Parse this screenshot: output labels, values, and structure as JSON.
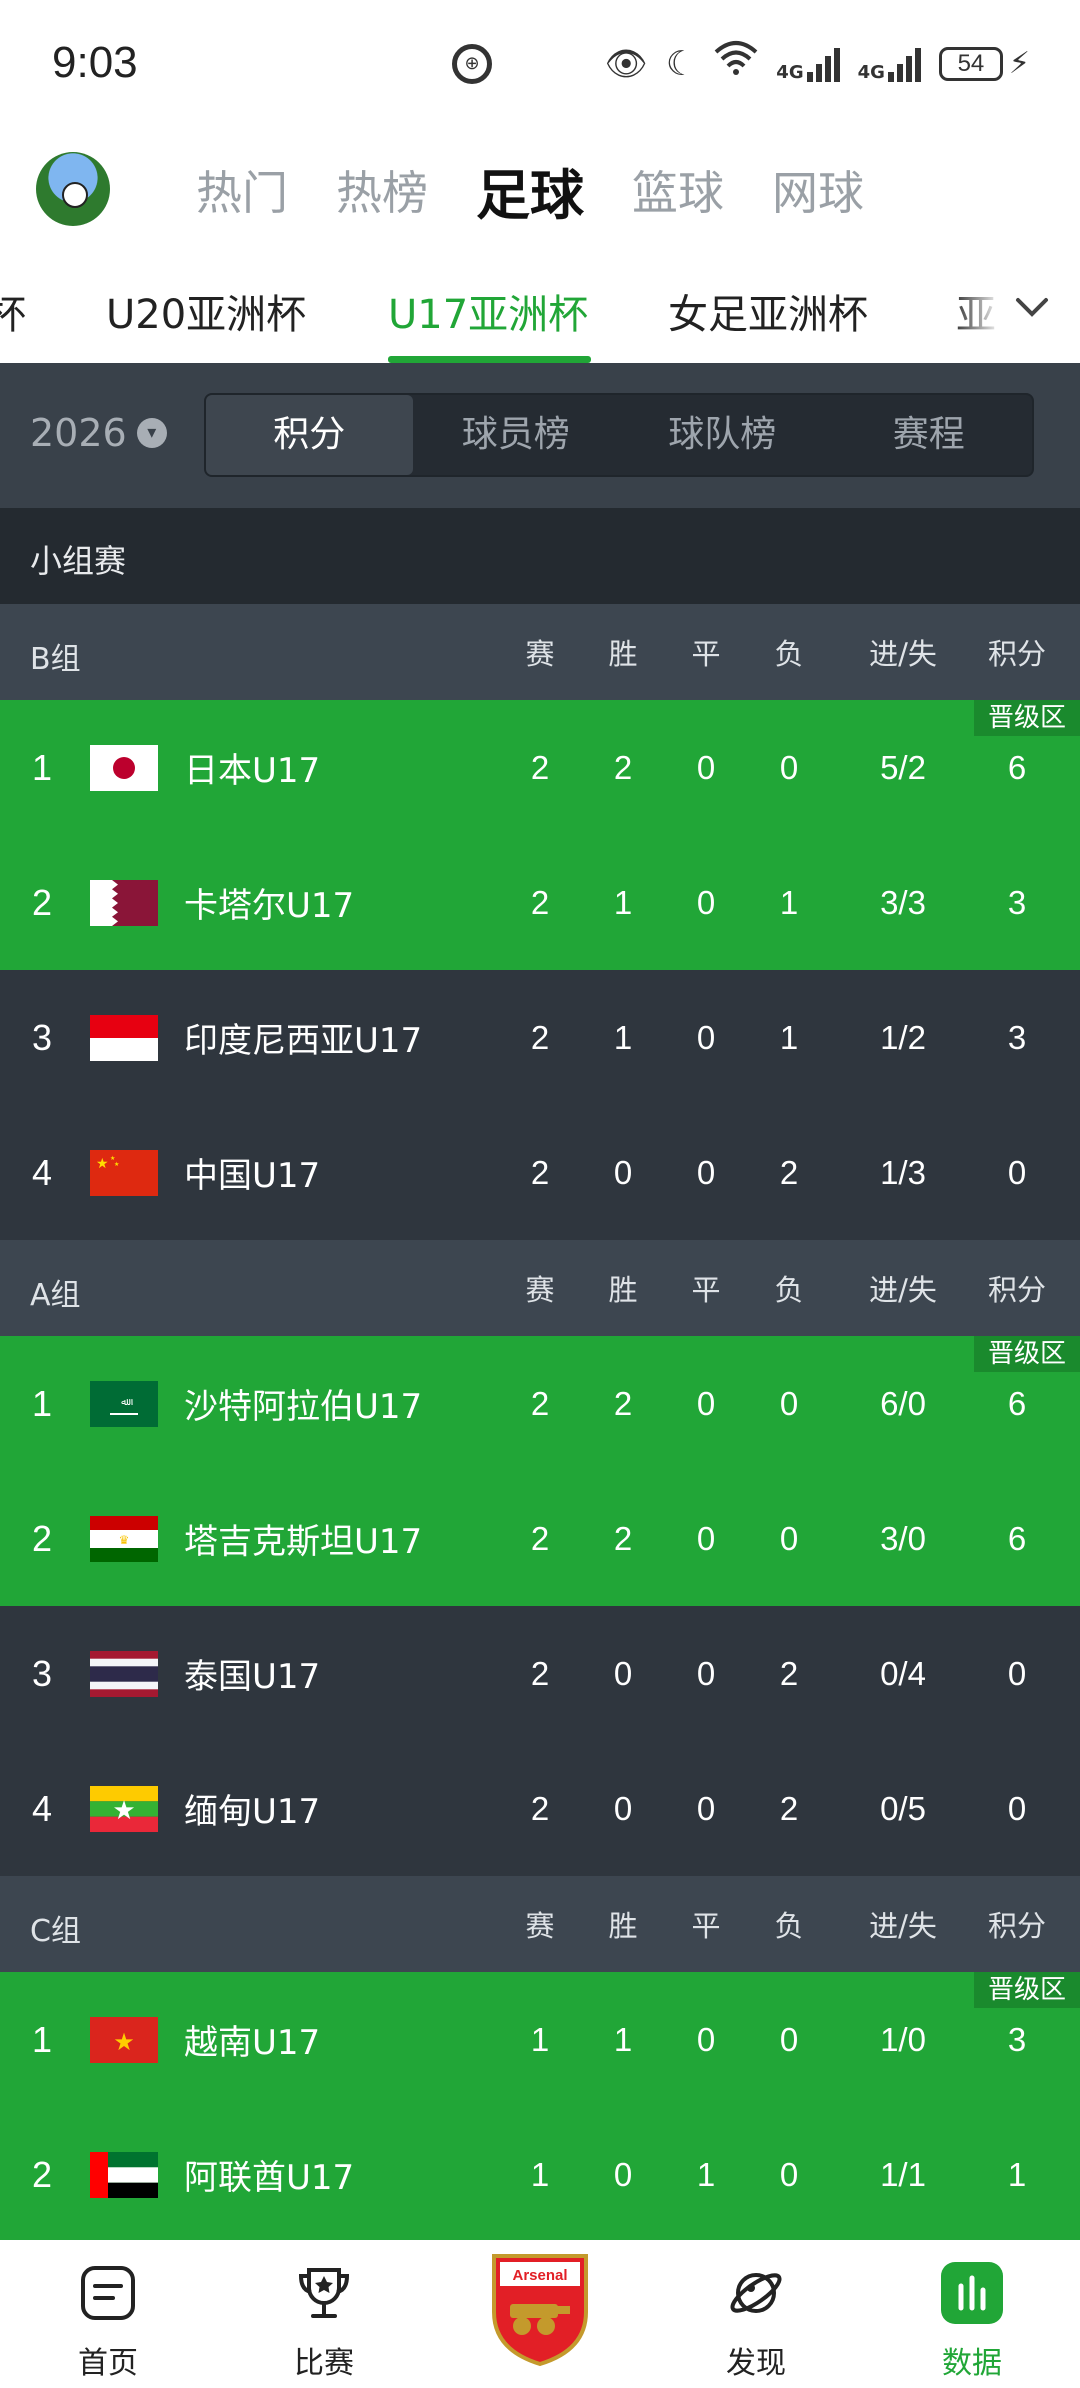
{
  "status": {
    "time": "9:03",
    "net1": "4G",
    "net2": "4G",
    "battery": "54"
  },
  "nav": {
    "tabs": [
      "热门",
      "热榜",
      "足球",
      "篮球",
      "网球"
    ],
    "active": "足球"
  },
  "competitions": [
    "杯",
    "U20亚洲杯",
    "U17亚洲杯",
    "女足亚洲杯",
    "亚"
  ],
  "filter": {
    "year": "2026",
    "segments": [
      "积分",
      "球员榜",
      "球队榜",
      "赛程"
    ]
  },
  "stage": "小组赛",
  "headers": [
    "赛",
    "胜",
    "平",
    "负",
    "进/失",
    "积分"
  ],
  "zone_label": "晋级区",
  "groups": [
    {
      "name": "B组",
      "rows": [
        {
          "rank": "1",
          "team": "日本U17",
          "p": "2",
          "w": "2",
          "d": "0",
          "l": "0",
          "gf": "5/2",
          "pts": "6",
          "flag": "japan"
        },
        {
          "rank": "2",
          "team": "卡塔尔U17",
          "p": "2",
          "w": "1",
          "d": "0",
          "l": "1",
          "gf": "3/3",
          "pts": "3",
          "flag": "qatar"
        },
        {
          "rank": "3",
          "team": "印度尼西亚U17",
          "p": "2",
          "w": "1",
          "d": "0",
          "l": "1",
          "gf": "1/2",
          "pts": "3",
          "flag": "indonesia"
        },
        {
          "rank": "4",
          "team": "中国U17",
          "p": "2",
          "w": "0",
          "d": "0",
          "l": "2",
          "gf": "1/3",
          "pts": "0",
          "flag": "china"
        }
      ]
    },
    {
      "name": "A组",
      "rows": [
        {
          "rank": "1",
          "team": "沙特阿拉伯U17",
          "p": "2",
          "w": "2",
          "d": "0",
          "l": "0",
          "gf": "6/0",
          "pts": "6",
          "flag": "saudi"
        },
        {
          "rank": "2",
          "team": "塔吉克斯坦U17",
          "p": "2",
          "w": "2",
          "d": "0",
          "l": "0",
          "gf": "3/0",
          "pts": "6",
          "flag": "tajikistan"
        },
        {
          "rank": "3",
          "team": "泰国U17",
          "p": "2",
          "w": "0",
          "d": "0",
          "l": "2",
          "gf": "0/4",
          "pts": "0",
          "flag": "thailand"
        },
        {
          "rank": "4",
          "team": "缅甸U17",
          "p": "2",
          "w": "0",
          "d": "0",
          "l": "2",
          "gf": "0/5",
          "pts": "0",
          "flag": "myanmar"
        }
      ]
    },
    {
      "name": "C组",
      "rows": [
        {
          "rank": "1",
          "team": "越南U17",
          "p": "1",
          "w": "1",
          "d": "0",
          "l": "0",
          "gf": "1/0",
          "pts": "3",
          "flag": "vietnam"
        },
        {
          "rank": "2",
          "team": "阿联酋U17",
          "p": "1",
          "w": "0",
          "d": "1",
          "l": "0",
          "gf": "1/1",
          "pts": "1",
          "flag": "uae"
        }
      ]
    }
  ],
  "bottom": {
    "home": "首页",
    "match": "比赛",
    "club": "Arsenal",
    "discover": "发现",
    "data": "数据"
  },
  "colors": {
    "accent": "#21a637",
    "qualify": "#21a637",
    "row": "#2f363e",
    "header": "#3d4650"
  }
}
